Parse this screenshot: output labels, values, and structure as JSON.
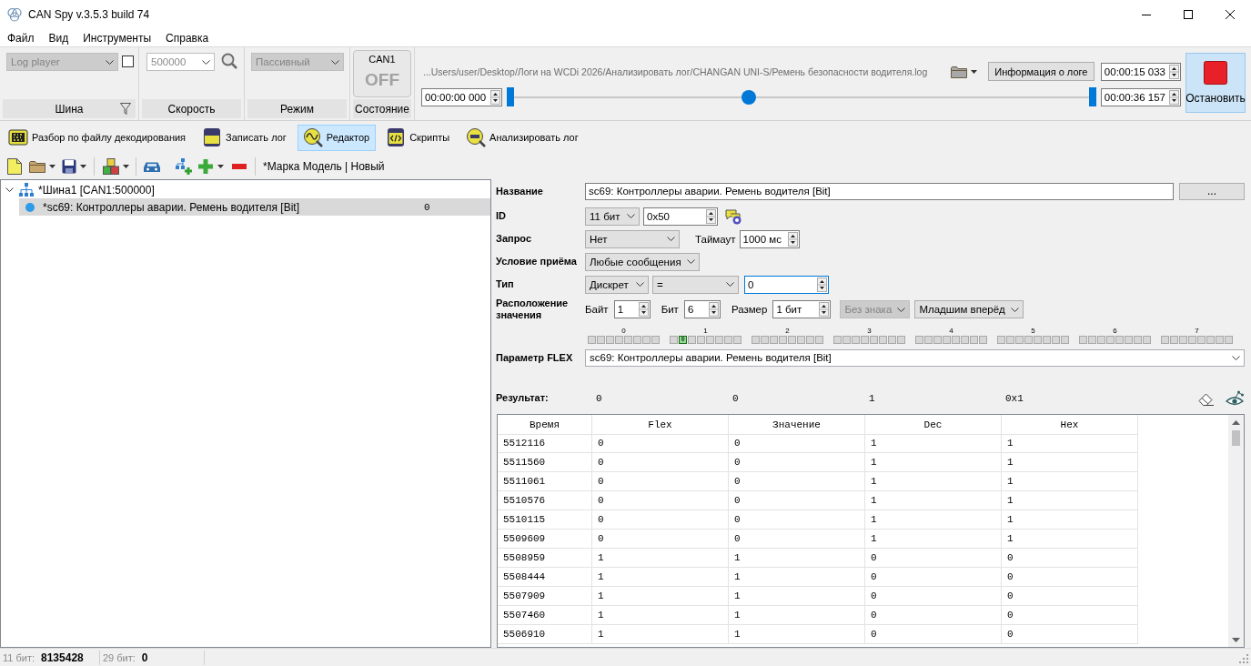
{
  "window": {
    "title": "CAN Spy v.3.5.3 build 74"
  },
  "menu": [
    "Файл",
    "Вид",
    "Инструменты",
    "Справка"
  ],
  "ribbon": {
    "groups": [
      {
        "kind": "bus",
        "label": "Шина",
        "combo": {
          "value": "Log player",
          "disabled": true
        },
        "checkbox": {
          "checked": false
        }
      },
      {
        "kind": "speed",
        "label": "Скорость",
        "combo": {
          "value": "500000",
          "disabled": true
        }
      },
      {
        "kind": "mode",
        "label": "Режим",
        "combo": {
          "value": "Пассивный",
          "disabled": true
        }
      },
      {
        "kind": "state",
        "label": "Состояние",
        "channel": "CAN1",
        "state": "OFF",
        "on": false
      }
    ],
    "player": {
      "file_path": "...Users/user/Desktop/Логи на WCDi 2026/Анализировать лог/CHANGAN UNI-S/Ремень безопасности водителя.log",
      "info_button": "Информация о логе",
      "current_time": "00:00:15 033",
      "start_time": "00:00:00 000",
      "level": 0.41,
      "end_time": "00:00:36 157"
    },
    "stop_button": {
      "label": "Остановить",
      "active": true
    }
  },
  "tabs": [
    {
      "label": "Разбор по файлу декодирования",
      "selected": false
    },
    {
      "label": "Записать лог",
      "selected": false
    },
    {
      "label": "Редактор",
      "selected": true
    },
    {
      "label": "Скрипты",
      "selected": false
    },
    {
      "label": "Анализировать лог",
      "selected": false
    }
  ],
  "toolbar": {
    "project": "*Марка Модель | Новый"
  },
  "tree": {
    "items": [
      {
        "label": "*Шина1 [CAN1:500000]",
        "expanded": true,
        "selected": false,
        "children": [
          {
            "label": "*sc69: Контроллеры аварии. Ремень водителя [Bit]",
            "value": "0",
            "selected": true
          }
        ]
      }
    ]
  },
  "form": {
    "name": {
      "label": "Название",
      "value": "sc69: Контроллеры аварии. Ремень водителя [Bit]",
      "button": "..."
    },
    "id": {
      "label": "ID",
      "format": "11 бит",
      "value": "0x50"
    },
    "request": {
      "label": "Запрос",
      "value": "Нет",
      "timeout_label": "Таймаут",
      "timeout": "1000 мс"
    },
    "condition": {
      "label": "Условие приёма",
      "value": "Любые сообщения"
    },
    "type": {
      "label": "Тип",
      "value": "Дискрет",
      "operator": "=",
      "operand": "0",
      "focused": true
    },
    "location": {
      "label": "Расположение значения",
      "fields": [
        {
          "kind": "spin",
          "label": "Байт",
          "value": "1",
          "disabled": false
        },
        {
          "kind": "spin",
          "label": "Бит",
          "value": "6",
          "disabled": false
        },
        {
          "kind": "spin",
          "label": "Размер",
          "value": "1 бит",
          "disabled": false
        },
        {
          "kind": "combo",
          "value": "Без знака",
          "disabled": true
        },
        {
          "kind": "combo",
          "value": "Младшим вперёд",
          "disabled": false
        }
      ]
    },
    "bit_map": {
      "bytes": [
        {
          "label": "0",
          "cells": [
            {
              "active": false
            },
            {
              "active": false
            },
            {
              "active": false
            },
            {
              "active": false
            },
            {
              "active": false
            },
            {
              "active": false
            },
            {
              "active": false
            },
            {
              "active": false
            }
          ]
        },
        {
          "label": "1",
          "cells": [
            {
              "active": false
            },
            {
              "active": true,
              "text": "0"
            },
            {
              "active": false
            },
            {
              "active": false
            },
            {
              "active": false
            },
            {
              "active": false
            },
            {
              "active": false
            },
            {
              "active": false
            }
          ]
        },
        {
          "label": "2",
          "cells": [
            {
              "active": false
            },
            {
              "active": false
            },
            {
              "active": false
            },
            {
              "active": false
            },
            {
              "active": false
            },
            {
              "active": false
            },
            {
              "active": false
            },
            {
              "active": false
            }
          ]
        },
        {
          "label": "3",
          "cells": [
            {
              "active": false
            },
            {
              "active": false
            },
            {
              "active": false
            },
            {
              "active": false
            },
            {
              "active": false
            },
            {
              "active": false
            },
            {
              "active": false
            },
            {
              "active": false
            }
          ]
        },
        {
          "label": "4",
          "cells": [
            {
              "active": false
            },
            {
              "active": false
            },
            {
              "active": false
            },
            {
              "active": false
            },
            {
              "active": false
            },
            {
              "active": false
            },
            {
              "active": false
            },
            {
              "active": false
            }
          ]
        },
        {
          "label": "5",
          "cells": [
            {
              "active": false
            },
            {
              "active": false
            },
            {
              "active": false
            },
            {
              "active": false
            },
            {
              "active": false
            },
            {
              "active": false
            },
            {
              "active": false
            },
            {
              "active": false
            }
          ]
        },
        {
          "label": "6",
          "cells": [
            {
              "active": false
            },
            {
              "active": false
            },
            {
              "active": false
            },
            {
              "active": false
            },
            {
              "active": false
            },
            {
              "active": false
            },
            {
              "active": false
            },
            {
              "active": false
            }
          ]
        },
        {
          "label": "7",
          "cells": [
            {
              "active": false
            },
            {
              "active": false
            },
            {
              "active": false
            },
            {
              "active": false
            },
            {
              "active": false
            },
            {
              "active": false
            },
            {
              "active": false
            },
            {
              "active": false
            }
          ]
        }
      ]
    },
    "flex_param": {
      "label": "Параметр FLEX",
      "value": "sc69: Контроллеры аварии. Ремень водителя [Bit]"
    }
  },
  "result": {
    "label": "Результат:",
    "values": [
      "0",
      "0",
      "1",
      "0x1"
    ]
  },
  "table": {
    "columns": [
      "Время",
      "Flex",
      "Значение",
      "Dec",
      "Hex"
    ],
    "rows": [
      [
        "5512116",
        "0",
        "0",
        "1",
        "1"
      ],
      [
        "5511560",
        "0",
        "0",
        "1",
        "1"
      ],
      [
        "5511061",
        "0",
        "0",
        "1",
        "1"
      ],
      [
        "5510576",
        "0",
        "0",
        "1",
        "1"
      ],
      [
        "5510115",
        "0",
        "0",
        "1",
        "1"
      ],
      [
        "5509609",
        "0",
        "0",
        "1",
        "1"
      ],
      [
        "5508959",
        "1",
        "1",
        "0",
        "0"
      ],
      [
        "5508444",
        "1",
        "1",
        "0",
        "0"
      ],
      [
        "5507909",
        "1",
        "1",
        "0",
        "0"
      ],
      [
        "5507460",
        "1",
        "1",
        "0",
        "0"
      ],
      [
        "5506910",
        "1",
        "1",
        "0",
        "0"
      ]
    ]
  },
  "status_bar": [
    {
      "label": "11 бит:",
      "value": "8135428"
    },
    {
      "label": "29 бит:",
      "value": "0"
    }
  ]
}
